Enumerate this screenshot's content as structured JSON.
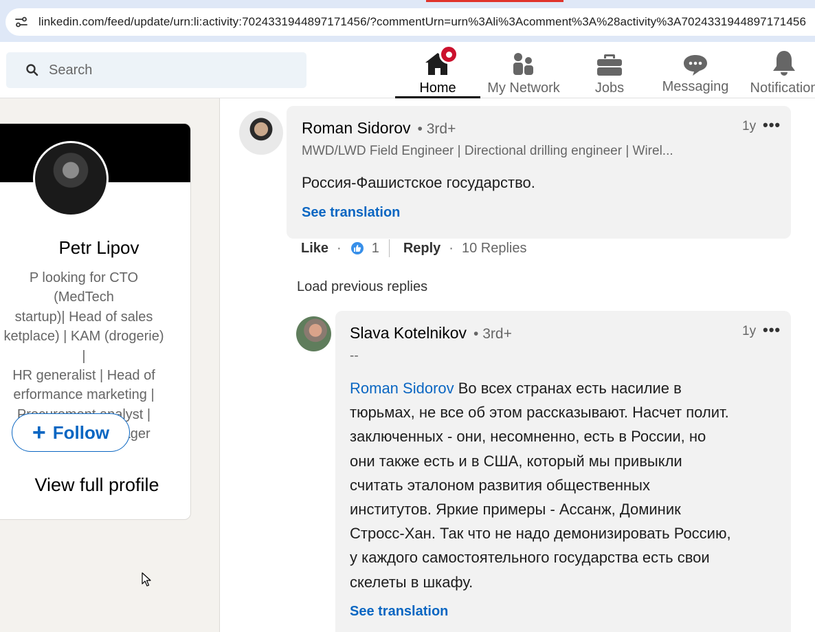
{
  "browser": {
    "url": "linkedin.com/feed/update/urn:li:activity:7024331944897171456/?commentUrn=urn%3Ali%3Acomment%3A%28activity%3A7024331944897171456"
  },
  "nav": {
    "search_placeholder": "Search",
    "items": [
      {
        "label": "Home",
        "icon": "home-icon"
      },
      {
        "label": "My Network",
        "icon": "network-icon"
      },
      {
        "label": "Jobs",
        "icon": "briefcase-icon"
      },
      {
        "label": "Messaging",
        "icon": "messaging-icon"
      },
      {
        "label": "Notification",
        "icon": "bell-icon"
      }
    ]
  },
  "profile": {
    "name": "Petr Lipov",
    "headline_lines": [
      "P looking for CTO (MedTech",
      "startup)| Head of sales",
      "ketplace) | KAM (drogerie) |",
      "HR generalist | Head of",
      "erformance marketing |",
      "Procurement analyst |",
      "Marketplace manager"
    ],
    "follow_label": "Follow",
    "view_full_profile": "View full profile"
  },
  "comment": {
    "author": "Roman Sidorov",
    "degree": "• 3rd+",
    "headline": "MWD/LWD Field Engineer | Directional drilling engineer | Wirel...",
    "time": "1y",
    "more": "•••",
    "text": "Россия-Фашистское государство.",
    "see_translation": "See translation",
    "actions": {
      "like": "Like",
      "dot": "·",
      "reaction_count": "1",
      "reply": "Reply",
      "replies": "10 Replies"
    }
  },
  "load_previous": "Load previous replies",
  "reply": {
    "author": "Slava Kotelnikov",
    "degree": "• 3rd+",
    "headline": "--",
    "time": "1y",
    "more": "•••",
    "mention": "Roman Sidorov",
    "text_lines": [
      " Во всех странах есть насилие в",
      "тюрьмах, не все об этом рассказывают. Насчет полит.",
      "заключенных - они, несомненно, есть в России, но",
      "они также есть и в США, который мы привыкли",
      "считать эталоном развития общественных",
      "институтов. Яркие примеры - Ассанж, Доминик",
      "Стросс-Хан. Так что не надо демонизировать Россию,",
      "у каждого самостоятельного государства есть свои",
      "скелеты в шкафу."
    ],
    "see_translation": "See translation"
  }
}
